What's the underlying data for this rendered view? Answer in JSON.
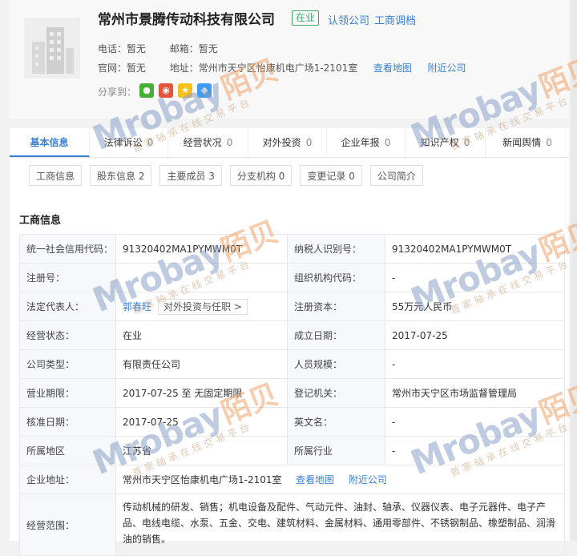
{
  "company": {
    "name": "常州市景腾传动科技有限公司",
    "status": "在业",
    "claim_label": "认领公司",
    "report_label": "工商调档"
  },
  "contact": {
    "phone_label": "电话：",
    "phone_value": "暂无",
    "email_label": "邮箱：",
    "email_value": "暂无",
    "website_label": "官网：",
    "website_value": "暂无",
    "address_label": "地址：",
    "address_value": "常州市天宁区怡康机电广场1-2101室",
    "map_link": "查看地图",
    "nearby_link": "附近公司",
    "share_label": "分享到："
  },
  "watermark": {
    "brand": "Mrobay",
    "cn": "陌贝",
    "slogan": "首家轴承在线交易平台"
  },
  "tabs": [
    {
      "label": "基本信息",
      "count": ""
    },
    {
      "label": "法律诉讼",
      "count": "0"
    },
    {
      "label": "经营状况",
      "count": "0"
    },
    {
      "label": "对外投资",
      "count": "0"
    },
    {
      "label": "企业年报",
      "count": "0"
    },
    {
      "label": "知识产权",
      "count": "0"
    },
    {
      "label": "新闻舆情",
      "count": "0"
    }
  ],
  "subtabs": [
    {
      "label": "工商信息"
    },
    {
      "label": "股东信息 2"
    },
    {
      "label": "主要成员 3"
    },
    {
      "label": "分支机构 0"
    },
    {
      "label": "变更记录 0"
    },
    {
      "label": "公司简介"
    }
  ],
  "section_title": "工商信息",
  "rows": [
    {
      "k1": "统一社会信用代码：",
      "v1": "91320402MA1PYMWM0T",
      "k2": "纳税人识别号：",
      "v2": "91320402MA1PYMWM0T"
    },
    {
      "k1": "注册号：",
      "v1": "",
      "k2": "组织机构代码：",
      "v2": "-"
    },
    {
      "k1": "法定代表人：",
      "v1": "郭春旺",
      "k2": "注册资本：",
      "v2": "55万元人民币"
    },
    {
      "k1": "经营状态：",
      "v1": "在业",
      "k2": "成立日期：",
      "v2": "2017-07-25"
    },
    {
      "k1": "公司类型：",
      "v1": "有限责任公司",
      "k2": "人员规模：",
      "v2": "-"
    },
    {
      "k1": "营业期限：",
      "v1": "2017-07-25 至 无固定期限",
      "k2": "登记机关：",
      "v2": "常州市天宁区市场监督管理局"
    },
    {
      "k1": "核准日期：",
      "v1": "2017-07-25",
      "k2": "英文名：",
      "v2": "-"
    },
    {
      "k1": "所属地区",
      "v1": "江苏省",
      "k2": "所属行业",
      "v2": "-"
    }
  ],
  "legal_rep_btn": "对外投资与任职 >",
  "address_row": {
    "label": "企业地址：",
    "value": "常州市天宁区怡康机电广场1-2101室",
    "map_link": "查看地图",
    "nearby_link": "附近公司"
  },
  "scope_row": {
    "label": "经营范围：",
    "value": "传动机械的研发、销售；机电设备及配件、气动元件、油封、轴承、仪器仪表、电子元器件、电子产品、电线电缆、水泵、五金、交电、建筑材料、金属材料、通用零部件、不锈钢制品、橡塑制品、润滑油的销售。"
  }
}
